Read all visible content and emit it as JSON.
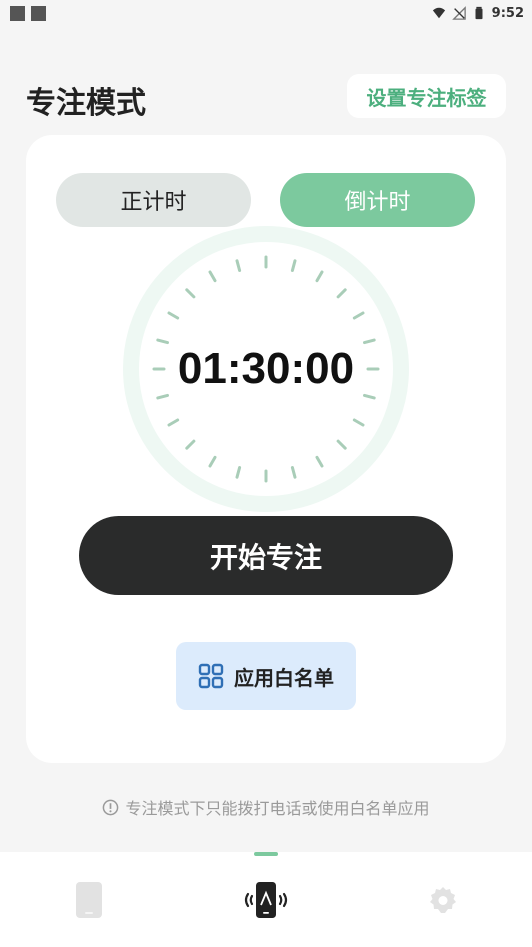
{
  "status_bar": {
    "time": "9:52",
    "icons": [
      "notification-square-icon",
      "notification-square-icon",
      "wifi-icon",
      "no-signal-icon",
      "battery-icon"
    ]
  },
  "header": {
    "title": "专注模式",
    "tag_button_label": "设置专注标签"
  },
  "card": {
    "mode_count_up": "正计时",
    "mode_count_down": "倒计时",
    "active_mode": "倒计时",
    "timer": "01:30:00",
    "start_label": "开始专注",
    "whitelist_label": "应用白名单"
  },
  "hint": {
    "text": "专注模式下只能拨打电话或使用白名单应用"
  },
  "bottom_nav": {
    "items": [
      {
        "icon": "phone-icon",
        "active": false
      },
      {
        "icon": "focus-phone-icon",
        "active": true
      },
      {
        "icon": "gear-icon",
        "active": false
      }
    ]
  },
  "colors": {
    "accent": "#7cc99e",
    "tag_text": "#4caf7e",
    "start_bg": "#2a2b2b",
    "whitelist_bg": "#dcebfc",
    "whitelist_icon": "#2f6fb5"
  }
}
